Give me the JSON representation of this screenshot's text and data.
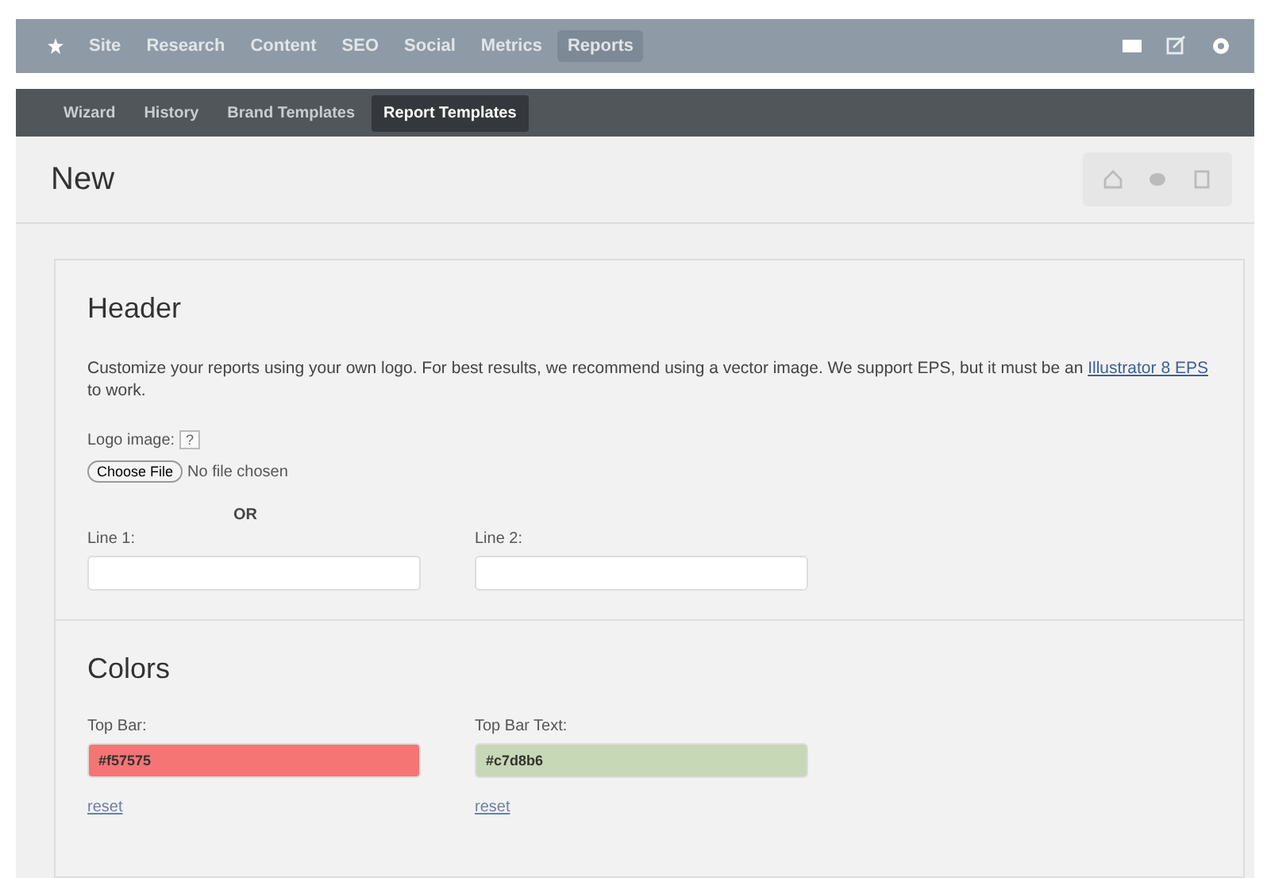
{
  "top_nav": {
    "items": [
      {
        "label": "Site",
        "selected": false
      },
      {
        "label": "Research",
        "selected": false
      },
      {
        "label": "Content",
        "selected": false
      },
      {
        "label": "SEO",
        "selected": false
      },
      {
        "label": "Social",
        "selected": false
      },
      {
        "label": "Metrics",
        "selected": false
      },
      {
        "label": "Reports",
        "selected": true
      }
    ]
  },
  "sub_nav": {
    "items": [
      {
        "label": "Wizard",
        "selected": false
      },
      {
        "label": "History",
        "selected": false
      },
      {
        "label": "Brand Templates",
        "selected": false
      },
      {
        "label": "Report Templates",
        "selected": true
      }
    ]
  },
  "page": {
    "title": "New"
  },
  "header_section": {
    "title": "Header",
    "description_before": "Customize your reports using your own logo. For best results, we recommend using a vector image. We support EPS, but it must be an ",
    "link": "Illustrator 8 EPS",
    "description_after": " to work.",
    "logo_label": "Logo image:",
    "help": "?",
    "file_button": "Choose File",
    "file_status": "No file chosen",
    "or": "OR",
    "fields": [
      {
        "label": "Line 1:"
      },
      {
        "label": "Line 2:"
      }
    ]
  },
  "colors_section": {
    "title": "Colors",
    "fields": [
      {
        "label": "Top Bar:",
        "value": "#f57575",
        "color": "#f57575",
        "reset": "reset"
      },
      {
        "label": "Top Bar Text:",
        "value": "#c7d8b6",
        "color": "#c7d8b6",
        "reset": "reset"
      }
    ]
  }
}
